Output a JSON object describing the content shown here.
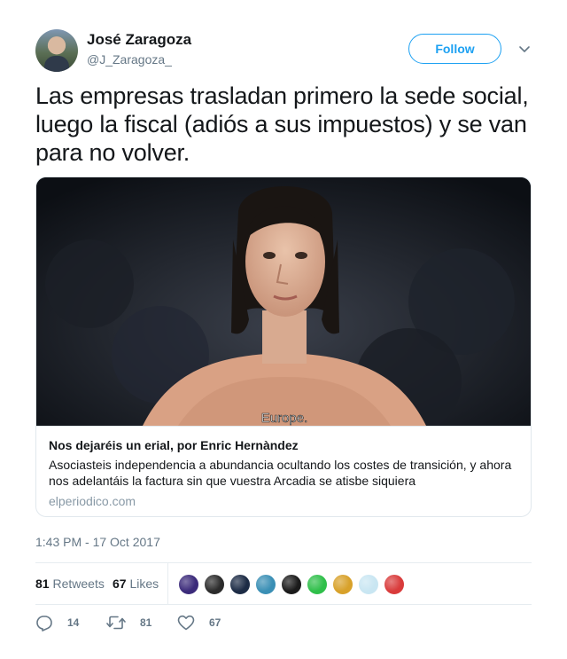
{
  "author": {
    "name": "José Zaragoza",
    "handle": "@J_Zaragoza_"
  },
  "follow_label": "Follow",
  "tweet": {
    "text": "Las empresas trasladan primero la sede social, luego la fiscal (adiós a sus impuestos) y se van para no volver."
  },
  "card": {
    "image_caption": "Europe.",
    "title": "Nos dejaréis un erial, por Enric Hernàndez",
    "description": "Asociasteis independencia a abundancia ocultando los costes de transición, y ahora nos adelantáis la factura sin que vuestra Arcadia se atisbe siquiera",
    "domain": "elperiodico.com"
  },
  "timestamp": "1:43 PM - 17 Oct 2017",
  "stats": {
    "retweets_count": "81",
    "retweets_label": "Retweets",
    "likes_count": "67",
    "likes_label": "Likes"
  },
  "liker_avatar_colors": [
    "#3b2a7a",
    "#2b2b2b",
    "#1c2b45",
    "#3a8fb5",
    "#1a1a1a",
    "#2fbf4a",
    "#d8a12a",
    "#c9e6f2",
    "#d93b3b"
  ],
  "actions": {
    "reply_count": "14",
    "retweet_count": "81",
    "like_count": "67"
  },
  "colors": {
    "accent": "#1da1f2",
    "text": "#14171a",
    "muted": "#657786"
  },
  "icons": [
    "chevron-down-icon",
    "reply-icon",
    "retweet-icon",
    "heart-icon"
  ]
}
